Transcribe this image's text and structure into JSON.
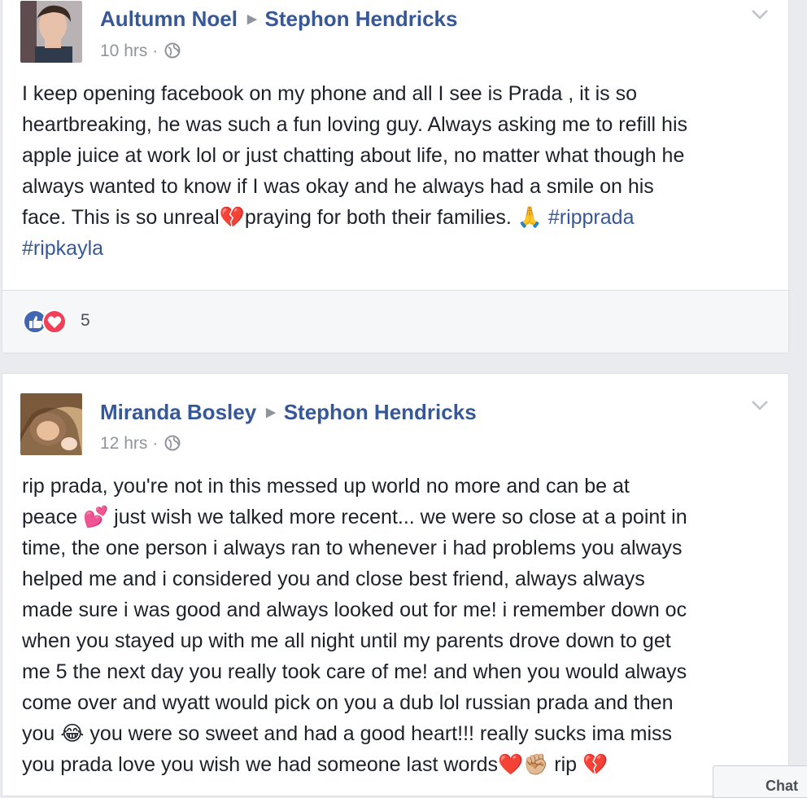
{
  "posts": [
    {
      "author": "Aultumn Noel",
      "target": "Stephon Hendricks",
      "time": "10 hrs ·",
      "lines": [
        "I keep opening facebook on my phone and all I see is Prada , it is so",
        "heartbreaking, he was such a fun loving guy. Always asking me to refill his",
        "apple juice at work lol or just chatting about life, no matter what though he",
        "always wanted to know if I was okay and he always had a smile on his"
      ],
      "line5": {
        "a": "face. This is so unreal",
        "emoji1": "💔",
        "b": "praying for both their families. ",
        "emoji2": "🙏",
        "hashtag1": "#ripprada"
      },
      "hashtag2": "#ripkayla",
      "reaction_count": "5"
    },
    {
      "author": "Miranda Bosley",
      "target": "Stephon Hendricks",
      "time": "12 hrs ·",
      "line1": "rip prada, you're not in this messed up world no more and can be at",
      "line2": {
        "a": "peace ",
        "emoji": "💕",
        "b": " just wish we talked more recent... we were so close at a point in"
      },
      "lines": [
        "time, the one person i always ran to whenever i had problems you always",
        "helped me and i considered you and close best friend, always always",
        "made sure i was good and always looked out for me! i remember down oc",
        "when you stayed up with me all night until my parents drove down to get",
        "me 5 the next day you really took care of me! and when you would always",
        "come over and wyatt would pick on you a dub lol russian prada and then"
      ],
      "line9": {
        "a": "you ",
        "emoji": "😂",
        "b": " you were so sweet and had a good heart!!! really sucks ima miss"
      },
      "line10": {
        "a": "you prada love you wish we had someone last words",
        "emoji1": "❤️",
        "emoji2": "✊🏼",
        "b": " rip ",
        "emoji3": "💔"
      }
    }
  ],
  "chat_tab_label": "Chat",
  "colors": {
    "link_blue": "#365899",
    "text": "#1d2129",
    "meta_gray": "#90949c",
    "like_blue": "#4267b2",
    "love_red": "#f33e58"
  }
}
